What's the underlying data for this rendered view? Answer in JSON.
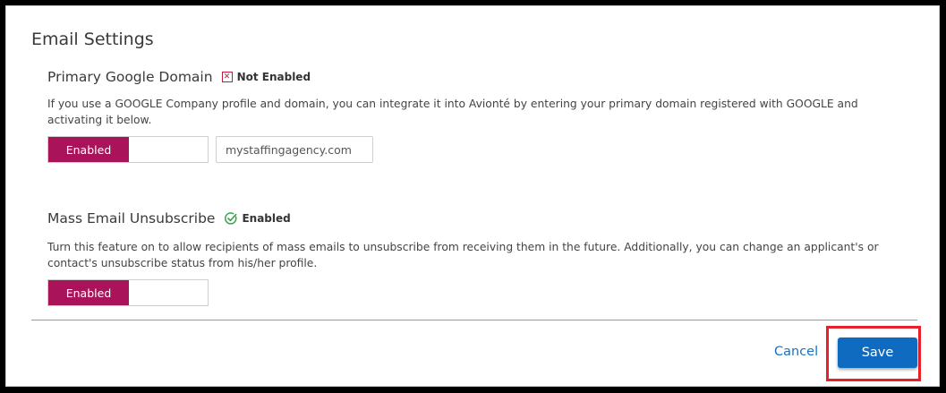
{
  "header": {
    "title": "Email Settings"
  },
  "google_domain": {
    "title": "Primary Google Domain",
    "status": "Not Enabled",
    "description": "If you use a GOOGLE Company profile and domain, you can integrate it into Avionté by entering your primary domain registered with GOOGLE and activating it below.",
    "toggle_label": "Enabled",
    "domain_value": "mystaffingagency.com"
  },
  "mass_unsubscribe": {
    "title": "Mass Email Unsubscribe",
    "status": "Enabled",
    "description": "Turn this feature on to allow recipients of mass emails to unsubscribe from receiving them in the future. Additionally, you can change an applicant's or contact's unsubscribe status from his/her profile.",
    "toggle_label": "Enabled"
  },
  "footer": {
    "cancel_label": "Cancel",
    "save_label": "Save"
  },
  "colors": {
    "toggle_on": "#a8135a",
    "primary": "#0f6bbf",
    "link": "#1a73c2",
    "not_enabled": "#c5193b",
    "enabled_check": "#3aa14a",
    "highlight": "#e8202a"
  },
  "icons": {
    "not_enabled": "x-box-icon",
    "enabled": "check-circle-icon"
  }
}
